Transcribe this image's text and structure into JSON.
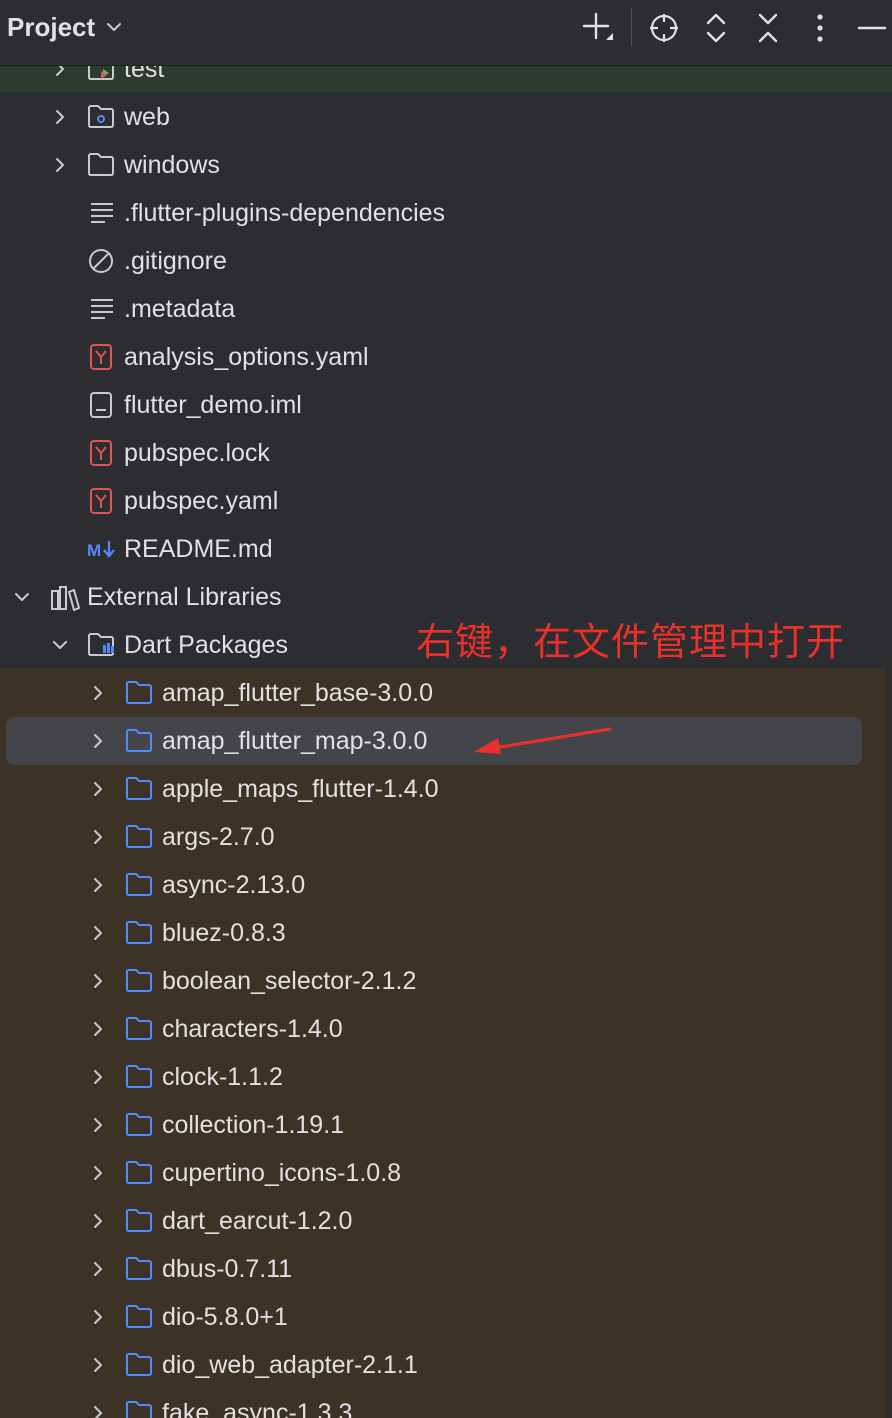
{
  "header": {
    "title": "Project",
    "icons": [
      "chevron-down-icon",
      "add-icon",
      "locate-icon",
      "expand-collapse-icon",
      "collapse-all-icon",
      "more-options-icon",
      "minimize-icon"
    ]
  },
  "colors": {
    "panel_bg": "#2b2d30",
    "text": "#dfe1e5",
    "folder_blue": "#548af7",
    "yaml_red": "#e05555",
    "markdown_blue": "#548af7",
    "selection": "#43454a",
    "library_band": "#3d3226",
    "annotation_red": "#e8312a"
  },
  "tree": {
    "partial_top": {
      "label": "test",
      "icon": "test-folder-icon"
    },
    "project_items": [
      {
        "label": "web",
        "icon": "web-folder-icon",
        "expandable": true
      },
      {
        "label": "windows",
        "icon": "folder-icon",
        "expandable": true
      },
      {
        "label": ".flutter-plugins-dependencies",
        "icon": "text-file-icon",
        "expandable": false
      },
      {
        "label": ".gitignore",
        "icon": "ignore-file-icon",
        "expandable": false
      },
      {
        "label": ".metadata",
        "icon": "text-file-icon",
        "expandable": false
      },
      {
        "label": "analysis_options.yaml",
        "icon": "yaml-file-icon",
        "expandable": false
      },
      {
        "label": "flutter_demo.iml",
        "icon": "iml-file-icon",
        "expandable": false
      },
      {
        "label": "pubspec.lock",
        "icon": "yaml-file-icon",
        "expandable": false
      },
      {
        "label": "pubspec.yaml",
        "icon": "yaml-file-icon",
        "expandable": false
      },
      {
        "label": "README.md",
        "icon": "markdown-file-icon",
        "expandable": false
      }
    ],
    "external_libraries": {
      "label": "External Libraries",
      "icon": "libraries-icon",
      "expanded": true
    },
    "dart_packages": {
      "label": "Dart Packages",
      "icon": "dart-packages-folder-icon",
      "expanded": true
    },
    "packages": [
      {
        "label": "amap_flutter_base-3.0.0"
      },
      {
        "label": "amap_flutter_map-3.0.0",
        "selected": true
      },
      {
        "label": "apple_maps_flutter-1.4.0"
      },
      {
        "label": "args-2.7.0"
      },
      {
        "label": "async-2.13.0"
      },
      {
        "label": "bluez-0.8.3"
      },
      {
        "label": "boolean_selector-2.1.2"
      },
      {
        "label": "characters-1.4.0"
      },
      {
        "label": "clock-1.1.2"
      },
      {
        "label": "collection-1.19.1"
      },
      {
        "label": "cupertino_icons-1.0.8"
      },
      {
        "label": "dart_earcut-1.2.0"
      },
      {
        "label": "dbus-0.7.11"
      },
      {
        "label": "dio-5.8.0+1"
      },
      {
        "label": "dio_web_adapter-2.1.1"
      },
      {
        "label": "fake_async-1.3.3"
      }
    ]
  },
  "annotation": {
    "text": "右键，在文件管理中打开"
  }
}
